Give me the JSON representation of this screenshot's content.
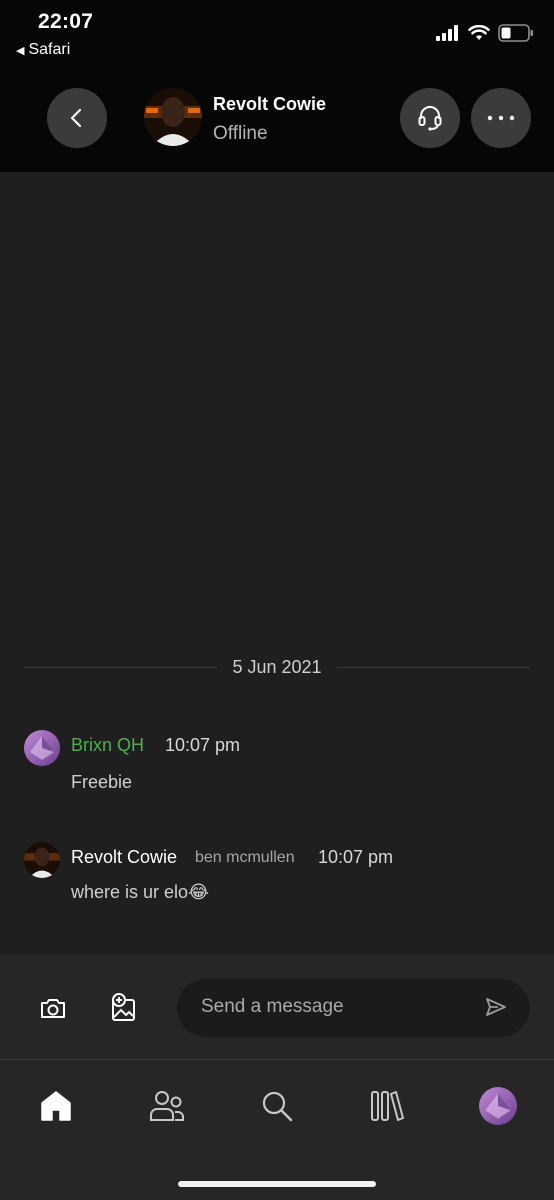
{
  "status_bar": {
    "time": "22:07",
    "back_app_label": "Safari",
    "icons": [
      "signal-icon",
      "wifi-icon",
      "battery-icon"
    ]
  },
  "header": {
    "contact_name": "Revolt Cowie",
    "contact_status": "Offline",
    "icons": [
      "chevron-left-icon",
      "headset-icon",
      "more-icon"
    ]
  },
  "chat": {
    "date_divider": "5 Jun 2021",
    "messages": [
      {
        "sender": "Brixn QH",
        "sender_sub": "",
        "time": "10:07 pm",
        "text": "Freebie",
        "sender_color": "#4caf50"
      },
      {
        "sender": "Revolt Cowie",
        "sender_sub": "ben mcmullen",
        "time": "10:07 pm",
        "text": "where is ur elo😂",
        "sender_color": "#ffffff"
      }
    ]
  },
  "composer": {
    "placeholder": "Send a message",
    "icons": [
      "camera-icon",
      "add-image-icon",
      "send-icon"
    ]
  },
  "tabbar": {
    "tabs": [
      "home",
      "friends",
      "search",
      "library",
      "profile"
    ],
    "icons": [
      "home-icon",
      "people-icon",
      "search-icon",
      "library-icon",
      "avatar"
    ]
  },
  "colors": {
    "background": "#1f1f1f",
    "header_bg": "#060606",
    "button_bg": "#3b3b3b",
    "composer_bg": "#262626",
    "accent_green": "#4caf50"
  }
}
